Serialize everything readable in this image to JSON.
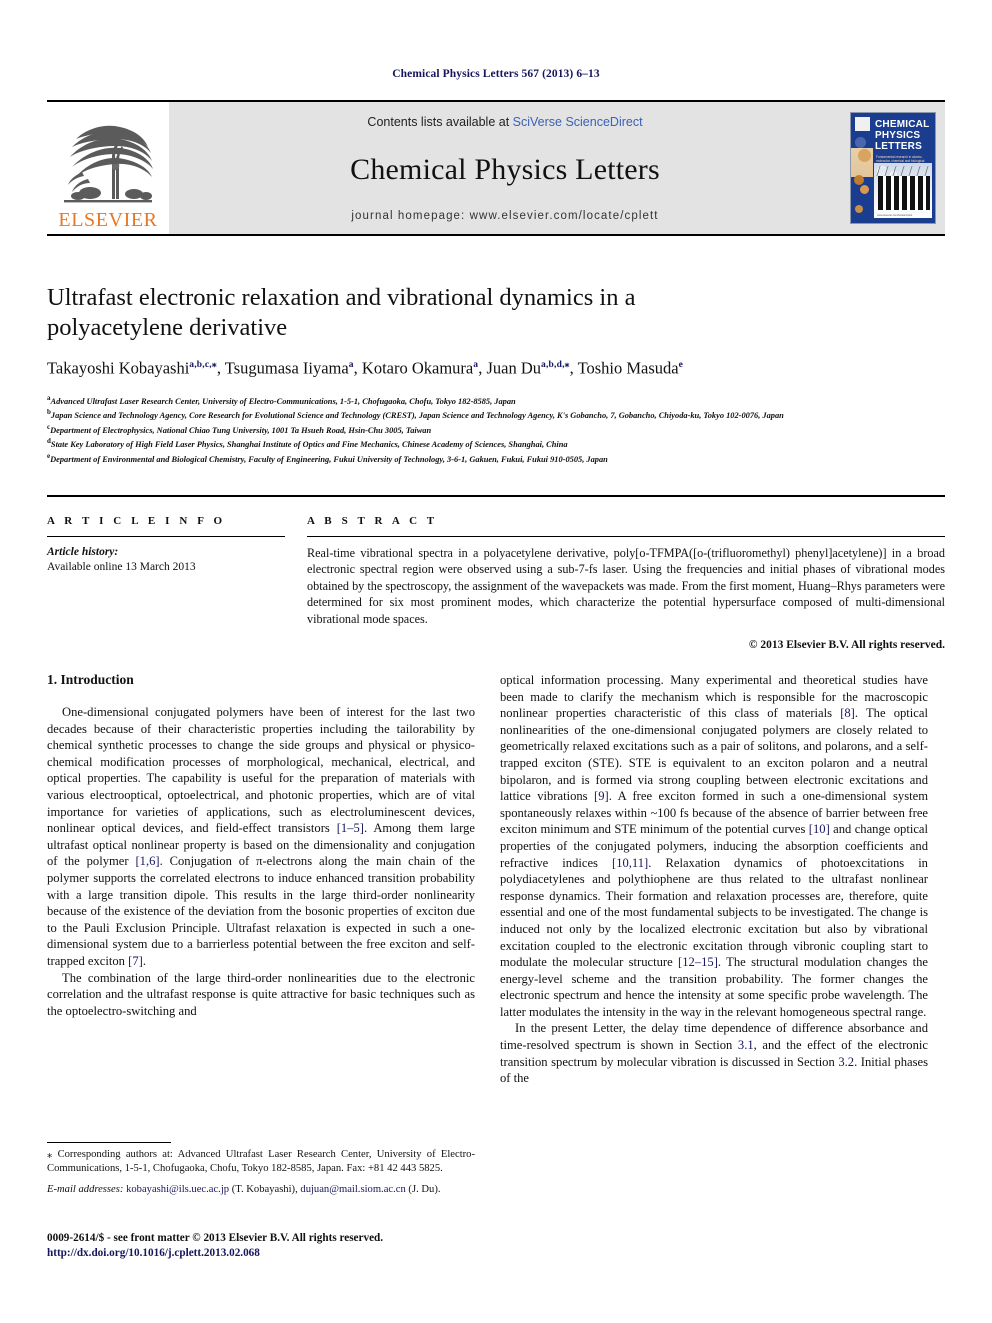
{
  "running_head": "Chemical Physics Letters 567 (2013) 6–13",
  "masthead": {
    "publisher_logo_label": "ELSEVIER",
    "contents_prefix": "Contents lists available at ",
    "contents_link": "SciVerse ScienceDirect",
    "journal_title": "Chemical Physics Letters",
    "homepage_label": "journal homepage: www.elsevier.com/locate/cplett",
    "cover": {
      "title_line1": "CHEMICAL",
      "title_line2": "PHYSICS",
      "title_line3": "LETTERS",
      "subtitle": "Fundamental research in atomic, molecular, chemical and biological physics",
      "photo_caption": "www.elsevier.com/locate/cplett",
      "brand_color": "#1b3d8f"
    }
  },
  "article": {
    "title": "Ultrafast electronic relaxation and vibrational dynamics in a polyacetylene derivative",
    "authors": [
      {
        "name": "Takayoshi Kobayashi",
        "marks": "a,b,c,",
        "star": true,
        "sep": ", "
      },
      {
        "name": "Tsugumasa Iiyama",
        "marks": "a",
        "star": false,
        "sep": ", "
      },
      {
        "name": "Kotaro Okamura",
        "marks": "a",
        "star": false,
        "sep": ", "
      },
      {
        "name": "Juan Du",
        "marks": "a,b,d,",
        "star": true,
        "sep": ", "
      },
      {
        "name": "Toshio Masuda",
        "marks": "e",
        "star": false,
        "sep": ""
      }
    ],
    "affiliations": [
      {
        "mark": "a",
        "text": "Advanced Ultrafast Laser Research Center, University of Electro-Communications, 1-5-1, Chofugaoka, Chofu, Tokyo 182-8585, Japan"
      },
      {
        "mark": "b",
        "text": "Japan Science and Technology Agency, Core Research for Evolutional Science and Technology (CREST), Japan Science and Technology Agency, K's Gobancho, 7, Gobancho, Chiyoda-ku, Tokyo 102-0076, Japan"
      },
      {
        "mark": "c",
        "text": "Department of Electrophysics, National Chiao Tung University, 1001 Ta Hsueh Road, Hsin-Chu 3005, Taiwan"
      },
      {
        "mark": "d",
        "text": "State Key Laboratory of High Field Laser Physics, Shanghai Institute of Optics and Fine Mechanics, Chinese Academy of Sciences, Shanghai, China"
      },
      {
        "mark": "e",
        "text": "Department of Environmental and Biological Chemistry, Faculty of Engineering, Fukui University of Technology, 3-6-1, Gakuen, Fukui, Fukui 910-0505, Japan"
      }
    ]
  },
  "article_info": {
    "heading": "A R T I C L E   I N F O",
    "history_label": "Article history:",
    "history_value": "Available online 13 March 2013"
  },
  "abstract": {
    "heading": "A B S T R A C T",
    "text": "Real-time vibrational spectra in a polyacetylene derivative, poly[o-TFMPA([o-(trifluoromethyl) phenyl]acetylene)] in a broad electronic spectral region were observed using a sub-7-fs laser. Using the frequencies and initial phases of vibrational modes obtained by the spectroscopy, the assignment of the wavepackets was made. From the first moment, Huang–Rhys parameters were determined for six most prominent modes, which characterize the potential hypersurface composed of multi-dimensional vibrational mode spaces.",
    "rights": "© 2013 Elsevier B.V. All rights reserved."
  },
  "body": {
    "section_heading": "1. Introduction",
    "left_paragraphs": [
      "One-dimensional conjugated polymers have been of interest for the last two decades because of their characteristic properties including the tailorability by chemical synthetic processes to change the side groups and physical or physico-chemical modification processes of morphological, mechanical, electrical, and optical properties. The capability is useful for the preparation of materials with various electrooptical, optoelectrical, and photonic properties, which are of vital importance for varieties of applications, such as electroluminescent devices, nonlinear optical devices, and field-effect transistors [1–5]. Among them large ultrafast optical nonlinear property is based on the dimensionality and conjugation of the polymer [1,6]. Conjugation of π-electrons along the main chain of the polymer supports the correlated electrons to induce enhanced transition probability with a large transition dipole. This results in the large third-order nonlinearity because of the existence of the deviation from the bosonic properties of exciton due to the Pauli Exclusion Principle. Ultrafast relaxation is expected in such a one-dimensional system due to a barrierless potential between the free exciton and self-trapped exciton [7].",
      "The combination of the large third-order nonlinearities due to the electronic correlation and the ultrafast response is quite attractive for basic techniques such as the optoelectro-switching and"
    ],
    "right_paragraphs": [
      "optical information processing. Many experimental and theoretical studies have been made to clarify the mechanism which is responsible for the macroscopic nonlinear properties characteristic of this class of materials [8]. The optical nonlinearities of the one-dimensional conjugated polymers are closely related to geometrically relaxed excitations such as a pair of solitons, and polarons, and a self-trapped exciton (STE). STE is equivalent to an exciton polaron and a neutral bipolaron, and is formed via strong coupling between electronic excitations and lattice vibrations [9]. A free exciton formed in such a one-dimensional system spontaneously relaxes within ~100 fs because of the absence of barrier between free exciton minimum and STE minimum of the potential curves [10] and change optical properties of the conjugated polymers, inducing the absorption coefficients and refractive indices [10,11]. Relaxation dynamics of photoexcitations in polydiacetylenes and polythiophene are thus related to the ultrafast nonlinear response dynamics. Their formation and relaxation processes are, therefore, quite essential and one of the most fundamental subjects to be investigated. The change is induced not only by the localized electronic excitation but also by vibrational excitation coupled to the electronic excitation through vibronic coupling start to modulate the molecular structure [12–15]. The structural modulation changes the energy-level scheme and the transition probability. The former changes the electronic spectrum and hence the intensity at some specific probe wavelength. The latter modulates the intensity in the way in the relevant homogeneous spectral range.",
      "In the present Letter, the delay time dependence of difference absorbance and time-resolved spectrum is shown in Section 3.1, and the effect of the electronic transition spectrum by molecular vibration is discussed in Section 3.2. Initial phases of the"
    ],
    "refs_left": [
      "[1–5]",
      "[1,6]",
      "[7]"
    ],
    "refs_right": [
      "[8]",
      "[9]",
      "[10]",
      "[10,11]",
      "[12–15]",
      "3.1",
      "3.2"
    ]
  },
  "footnote": {
    "corresponding": "⁎ Corresponding authors at: Advanced Ultrafast Laser Research Center, University of Electro-Communications, 1-5-1, Chofugaoka, Chofu, Tokyo 182-8585, Japan. Fax: +81 42 443 5825.",
    "email_label": "E-mail addresses:",
    "email_1": "kobayashi@ils.uec.ac.jp",
    "email_1_owner": "(T. Kobayashi),",
    "email_2": "dujuan@mail.siom.ac.cn",
    "email_2_owner": "(J. Du)."
  },
  "imprint": {
    "issn_line": "0009-2614/$ - see front matter © 2013 Elsevier B.V. All rights reserved.",
    "doi": "http://dx.doi.org/10.1016/j.cplett.2013.02.068"
  }
}
